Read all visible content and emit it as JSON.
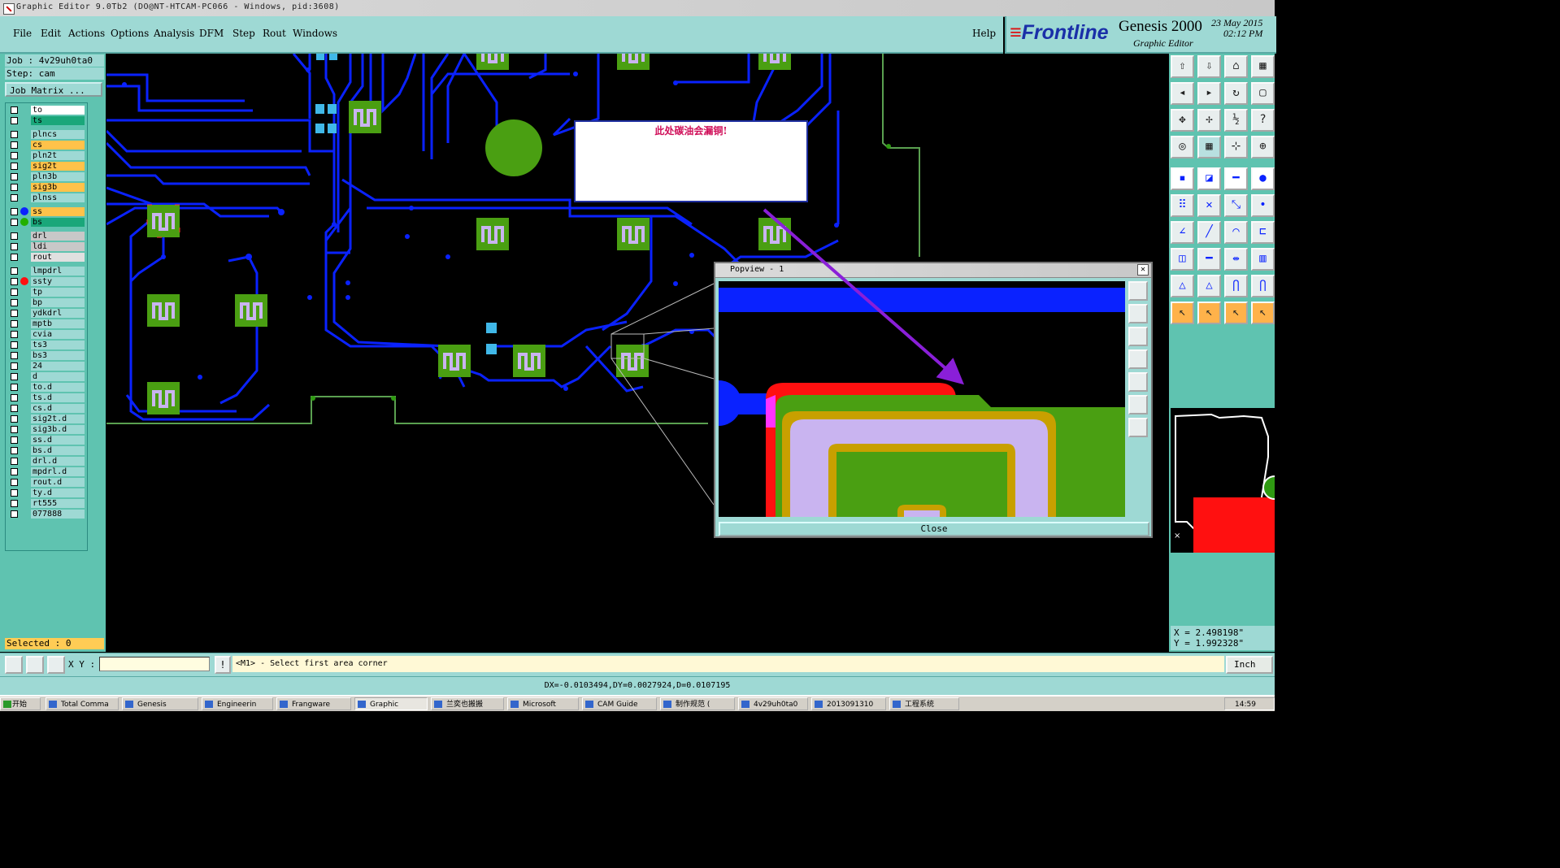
{
  "window": {
    "title": "Graphic Editor 9.0Tb2 (DO@NT-HTCAM-PC066 - Windows, pid:3608)"
  },
  "menu": {
    "items": [
      "File",
      "Edit",
      "Actions",
      "Options",
      "Analysis",
      "DFM",
      "Step",
      "Rout",
      "Windows"
    ],
    "help": "Help"
  },
  "brand": {
    "logo": "Frontline",
    "product": "Genesis 2000",
    "subtitle": "Graphic Editor",
    "date": "23 May 2015",
    "time": "02:12 PM"
  },
  "job": {
    "job_line": "Job : 4v29uh0ta0",
    "step_line": "Step: cam",
    "matrix_button": "Job Matrix ..."
  },
  "layers": [
    {
      "name": "to",
      "color": "#ffffff"
    },
    {
      "name": "ts",
      "color": "#1aa77a"
    },
    {
      "name": "plncs",
      "color": "#9ed9d4"
    },
    {
      "name": "cs",
      "color": "#ffc24a"
    },
    {
      "name": "pln2t",
      "color": "#9ed9d4"
    },
    {
      "name": "sig2t",
      "color": "#ffc24a"
    },
    {
      "name": "pln3b",
      "color": "#9ed9d4"
    },
    {
      "name": "sig3b",
      "color": "#ffc24a"
    },
    {
      "name": "plnss",
      "color": "#9ed9d4"
    },
    {
      "name": "ss",
      "color": "#ffc24a",
      "dot": "#0a22ff"
    },
    {
      "name": "bs",
      "color": "#1aa77a",
      "dot": "#22b000"
    },
    {
      "name": "drl",
      "color": "#c8c8c8"
    },
    {
      "name": "ldi",
      "color": "#c8c8c8"
    },
    {
      "name": "rout",
      "color": "#e0e0e0"
    },
    {
      "name": "lmpdrl",
      "color": "#9ed9d4"
    },
    {
      "name": "ssty",
      "color": "#9ed9d4",
      "dot": "#ff1010"
    },
    {
      "name": "tp",
      "color": "#9ed9d4"
    },
    {
      "name": "bp",
      "color": "#9ed9d4"
    },
    {
      "name": "ydkdrl",
      "color": "#9ed9d4"
    },
    {
      "name": "mptb",
      "color": "#9ed9d4"
    },
    {
      "name": "cvia",
      "color": "#9ed9d4"
    },
    {
      "name": "ts3",
      "color": "#9ed9d4"
    },
    {
      "name": "bs3",
      "color": "#9ed9d4"
    },
    {
      "name": "24",
      "color": "#9ed9d4"
    },
    {
      "name": "d",
      "color": "#9ed9d4"
    },
    {
      "name": "to.d",
      "color": "#9ed9d4"
    },
    {
      "name": "ts.d",
      "color": "#9ed9d4"
    },
    {
      "name": "cs.d",
      "color": "#9ed9d4"
    },
    {
      "name": "sig2t.d",
      "color": "#9ed9d4"
    },
    {
      "name": "sig3b.d",
      "color": "#9ed9d4"
    },
    {
      "name": "ss.d",
      "color": "#9ed9d4"
    },
    {
      "name": "bs.d",
      "color": "#9ed9d4"
    },
    {
      "name": "drl.d",
      "color": "#9ed9d4"
    },
    {
      "name": "mpdrl.d",
      "color": "#9ed9d4"
    },
    {
      "name": "rout.d",
      "color": "#9ed9d4"
    },
    {
      "name": "ty.d",
      "color": "#9ed9d4"
    },
    {
      "name": "rt555",
      "color": "#9ed9d4"
    },
    {
      "name": "077888",
      "color": "#9ed9d4"
    }
  ],
  "selected": "Selected : 0",
  "annotation": "此处碳油会漏铜!",
  "popview": {
    "title": "Popview - 1",
    "close_button": "Close"
  },
  "coordinates": {
    "x": "X = 2.498198\"",
    "y": "Y = 1.992328\""
  },
  "command": {
    "xy_label": "X Y :",
    "xy_value": "",
    "prompt": "<M1> - Select first area corner",
    "units": "Inch"
  },
  "status": "DX=-0.0103494,DY=0.0027924,D=0.0107195",
  "taskbar": {
    "start": "开始",
    "tasks": [
      "Total Comma",
      "Genesis",
      "Engineerin",
      "Frangware",
      "Graphic",
      "兰奕也搬搬",
      "Microsoft",
      "CAM Guide",
      "制作规范 (",
      "4v29uh0ta0",
      "2013091310",
      "工程系统"
    ],
    "clock": "14:59"
  },
  "colors": {
    "panel": "#9ed9d4",
    "panel_dark": "#5fc3b0",
    "trace": "#0a22ff",
    "pad": "#2f9a12",
    "annotation_text": "#d0105a",
    "arrow": "#8a1fd8"
  }
}
